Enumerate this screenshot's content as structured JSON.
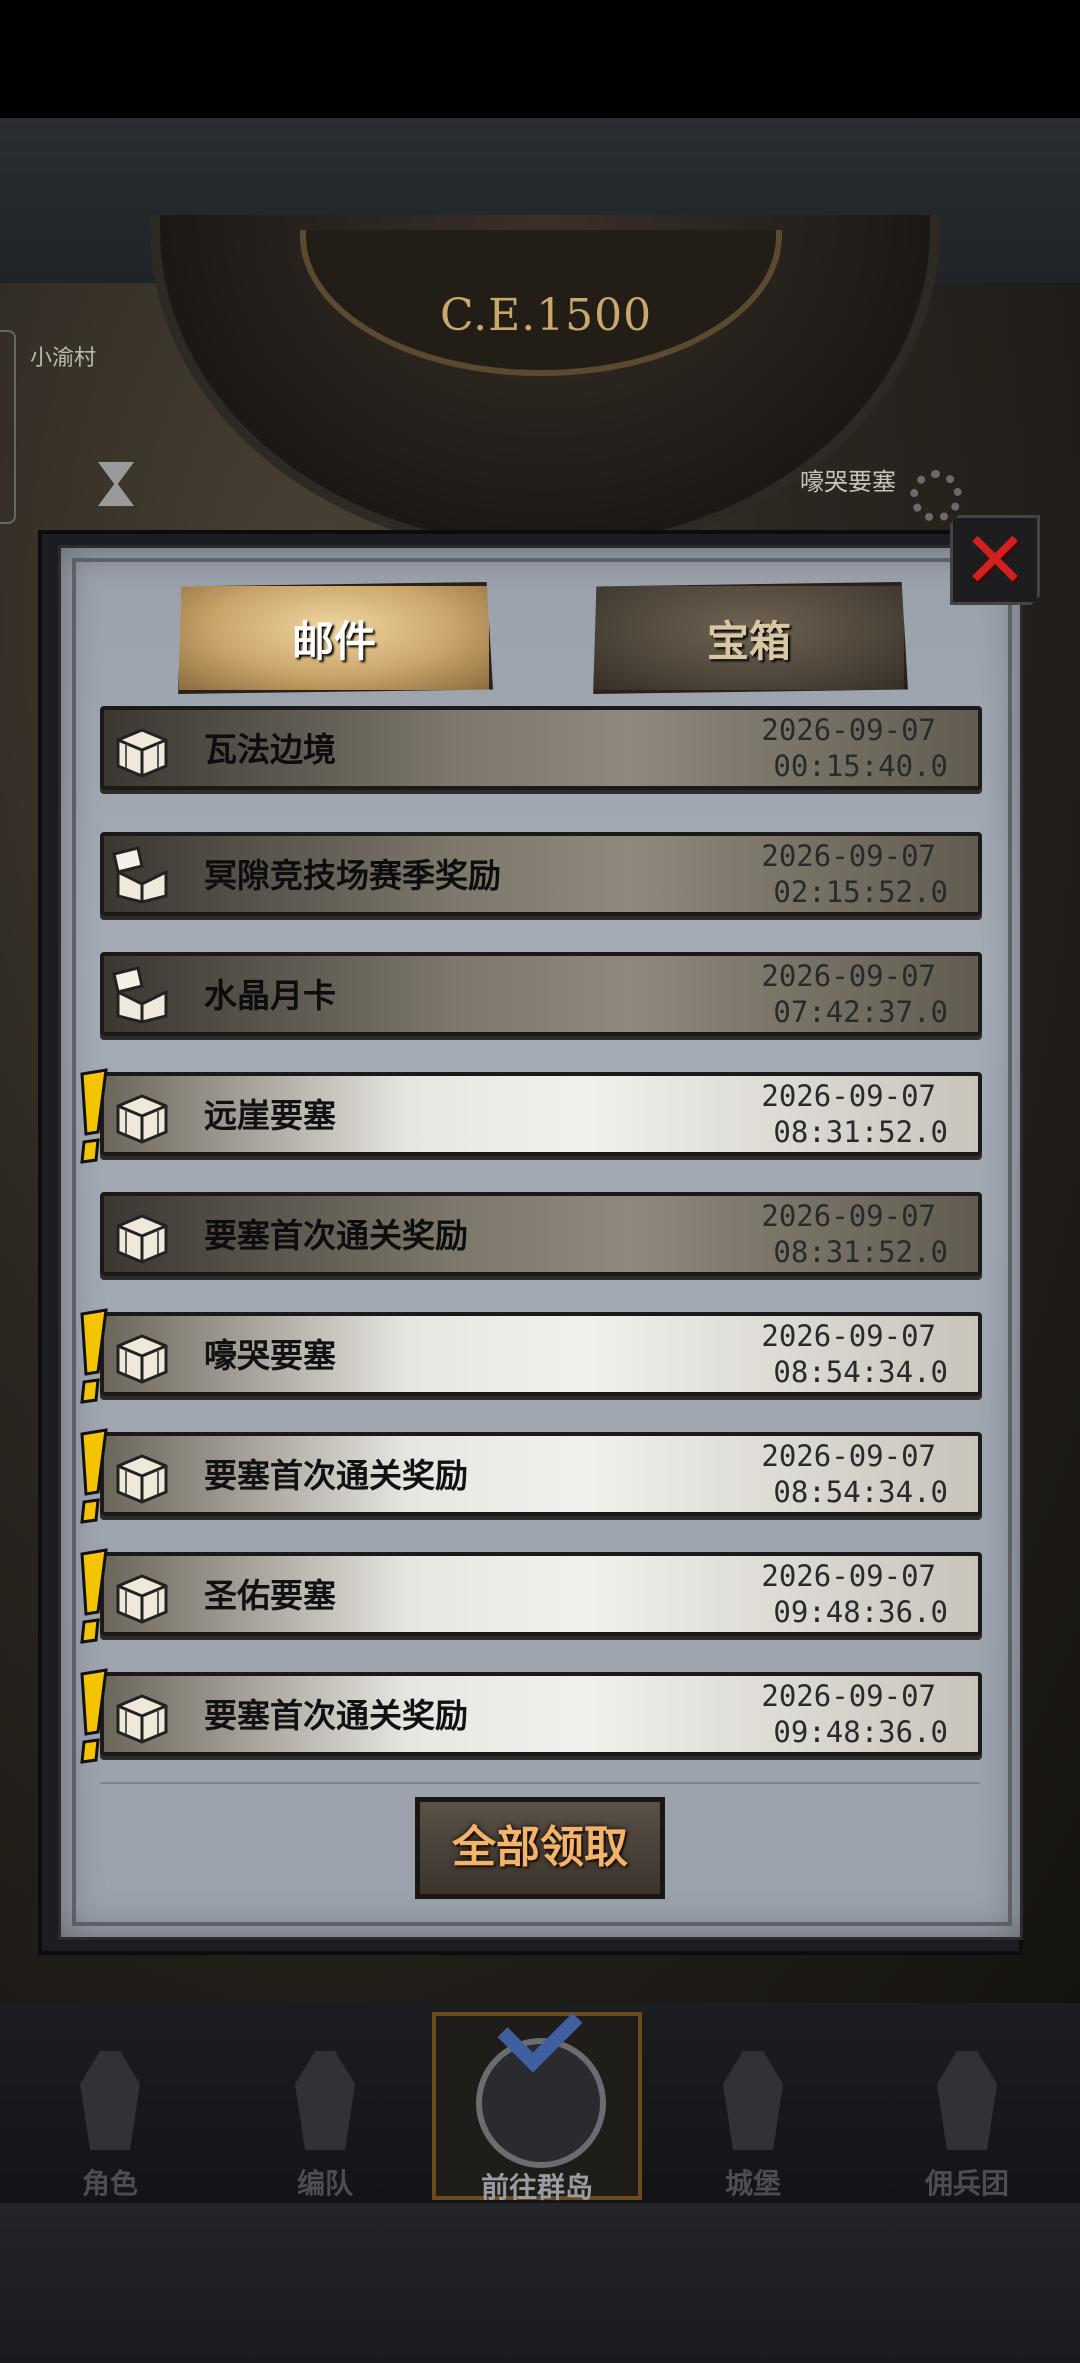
{
  "background": {
    "era": "C.E.1500",
    "map_label_left": "小渝村",
    "map_label_right": "嚎哭要塞"
  },
  "tabs": [
    {
      "label": "邮件",
      "active": true
    },
    {
      "label": "宝箱",
      "active": false
    }
  ],
  "mails": [
    {
      "title": "瓦法边境",
      "date": "2026-09-07",
      "time": "00:15:40.0",
      "unread": false,
      "opened": false
    },
    {
      "title": "冥隙竞技场赛季奖励",
      "date": "2026-09-07",
      "time": "02:15:52.0",
      "unread": false,
      "opened": true
    },
    {
      "title": "水晶月卡",
      "date": "2026-09-07",
      "time": "07:42:37.0",
      "unread": false,
      "opened": true
    },
    {
      "title": "远崖要塞",
      "date": "2026-09-07",
      "time": "08:31:52.0",
      "unread": true,
      "opened": false
    },
    {
      "title": "要塞首次通关奖励",
      "date": "2026-09-07",
      "time": "08:31:52.0",
      "unread": false,
      "opened": false
    },
    {
      "title": "嚎哭要塞",
      "date": "2026-09-07",
      "time": "08:54:34.0",
      "unread": true,
      "opened": false
    },
    {
      "title": "要塞首次通关奖励",
      "date": "2026-09-07",
      "time": "08:54:34.0",
      "unread": true,
      "opened": false
    },
    {
      "title": "圣佑要塞",
      "date": "2026-09-07",
      "time": "09:48:36.0",
      "unread": true,
      "opened": false
    },
    {
      "title": "要塞首次通关奖励",
      "date": "2026-09-07",
      "time": "09:48:36.0",
      "unread": true,
      "opened": false
    }
  ],
  "claim_all_label": "全部领取",
  "nav": [
    {
      "label": "角色",
      "icon": "knight-icon",
      "active": false
    },
    {
      "label": "编队",
      "icon": "helmet-icon",
      "active": false
    },
    {
      "label": "前往群岛",
      "icon": "globe-icon",
      "active": true
    },
    {
      "label": "城堡",
      "icon": "castle-icon",
      "active": false
    },
    {
      "label": "佣兵团",
      "icon": "ship-icon",
      "active": false
    }
  ],
  "colors": {
    "close": "#d22020",
    "claim_text": "#f2b46a",
    "alert": "#f5c400"
  }
}
